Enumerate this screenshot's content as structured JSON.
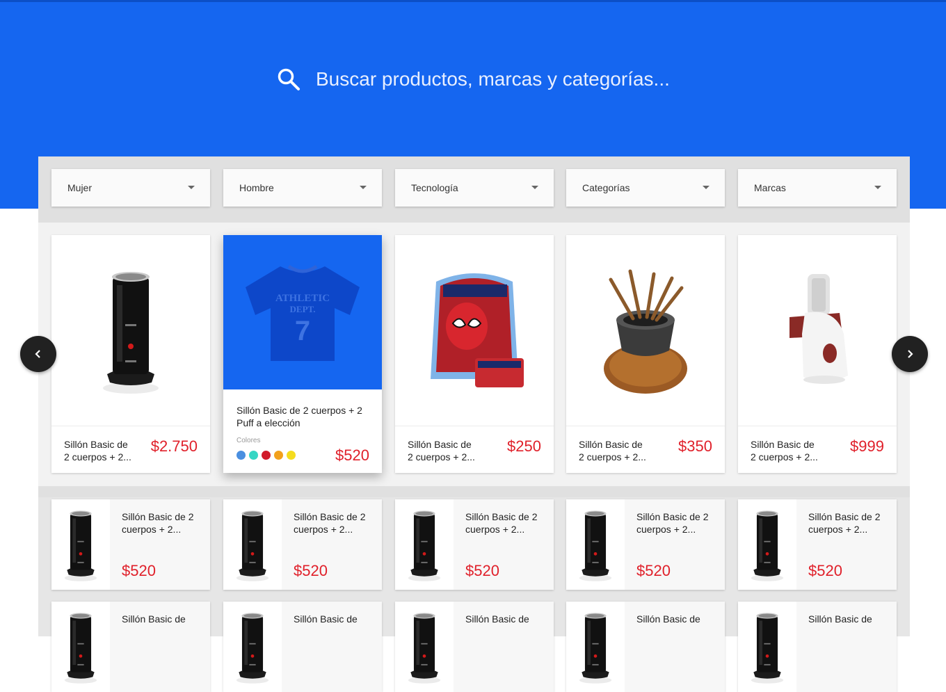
{
  "search": {
    "placeholder": "Buscar productos, marcas y categorías...",
    "icon": "search-icon"
  },
  "filters": [
    {
      "label": "Mujer"
    },
    {
      "label": "Hombre"
    },
    {
      "label": "Tecnología"
    },
    {
      "label": "Categorías"
    },
    {
      "label": "Marcas"
    }
  ],
  "carousel": {
    "prev_icon": "chevron-left-icon",
    "next_icon": "chevron-right-icon",
    "products": [
      {
        "title": "Sillón Basic de 2 cuerpos + 2...",
        "price": "$2.750",
        "image": "milk-frother"
      },
      {
        "title": "Sillón Basic de 2 cuerpos + 2 Puff a elección",
        "price": "$520",
        "image": "t-shirt",
        "colors_label": "Colores",
        "colors": [
          "#4a8fe0",
          "#36d6c4",
          "#d11a2a",
          "#f2a01c",
          "#f5dc1e"
        ]
      },
      {
        "title": "Sillón Basic de 2 cuerpos + 2...",
        "price": "$250",
        "image": "spiderman-backpack"
      },
      {
        "title": "Sillón Basic de 2 cuerpos + 2...",
        "price": "$350",
        "image": "fondue-set"
      },
      {
        "title": "Sillón Basic de 2 cuerpos + 2...",
        "price": "$999",
        "image": "food-processor"
      }
    ]
  },
  "list_rows": [
    [
      {
        "title": "Sillón Basic de 2 cuerpos + 2...",
        "price": "$520"
      },
      {
        "title": "Sillón Basic de 2 cuerpos + 2...",
        "price": "$520"
      },
      {
        "title": "Sillón Basic de 2 cuerpos + 2...",
        "price": "$520"
      },
      {
        "title": "Sillón Basic de 2 cuerpos + 2...",
        "price": "$520"
      },
      {
        "title": "Sillón Basic de 2 cuerpos + 2...",
        "price": "$520"
      }
    ],
    [
      {
        "title": "Sillón Basic de",
        "price": ""
      },
      {
        "title": "Sillón Basic de",
        "price": ""
      },
      {
        "title": "Sillón Basic de",
        "price": ""
      },
      {
        "title": "Sillón Basic de",
        "price": ""
      },
      {
        "title": "Sillón Basic de",
        "price": ""
      }
    ]
  ],
  "colors": {
    "brand": "#1566f0",
    "price": "#e0202a",
    "arrow": "#212121"
  }
}
